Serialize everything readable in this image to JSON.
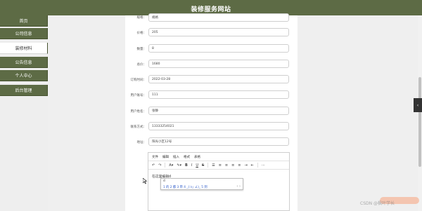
{
  "header": {
    "title": "装修服务网站"
  },
  "sidebar": {
    "items": [
      {
        "label": "首页",
        "active": false
      },
      {
        "label": "公司信息",
        "active": false
      },
      {
        "label": "装修材料",
        "active": true
      },
      {
        "label": "公告信息",
        "active": false
      },
      {
        "label": "个人中心",
        "active": false
      },
      {
        "label": "后台管理",
        "active": false
      }
    ]
  },
  "form": {
    "fields": [
      {
        "label": "规格：",
        "value": "规格"
      },
      {
        "label": "价格：",
        "value": "205"
      },
      {
        "label": "数量：",
        "value": "8"
      },
      {
        "label": "总价：",
        "value": "1680"
      },
      {
        "label": "订购时间：",
        "value": "2022-03-28"
      },
      {
        "label": "用户账号：",
        "value": "111"
      },
      {
        "label": "用户姓名：",
        "value": "张静"
      },
      {
        "label": "联系方式：",
        "value": "13333254021"
      },
      {
        "label": "地址：",
        "value": "阳光小区12号"
      }
    ]
  },
  "editor": {
    "menu": [
      "文件",
      "编辑",
      "插入",
      "格式",
      "表格"
    ],
    "toolbar_icons": [
      "undo-icon",
      "redo-icon",
      "text-color-icon",
      "highlight-icon",
      "bold-icon",
      "italic-icon",
      "underline-icon",
      "strikethrough-icon",
      "list-icon",
      "align-left-icon",
      "align-center-icon",
      "align-right-icon",
      "align-justify-icon",
      "indent-icon",
      "outdent-icon",
      "more-icon"
    ],
    "toolbar_glyphs": [
      "↶",
      "↷",
      "A▾",
      "✎▾",
      "B",
      "I",
      "U",
      "S",
      "☰",
      "≡",
      "≡",
      "≡",
      "≡",
      "⇥",
      "⇤",
      "⋯"
    ],
    "content": "在这里编辑d"
  },
  "ime": {
    "composition": "d",
    "candidates": "1 的  2 都  3 带  4 _(:з」∠)_  5 到",
    "arrow": "‹ ›"
  },
  "side_tab": {
    "glyph": "‹"
  },
  "watermark": {
    "text": "CSDN @枫叶学长"
  }
}
